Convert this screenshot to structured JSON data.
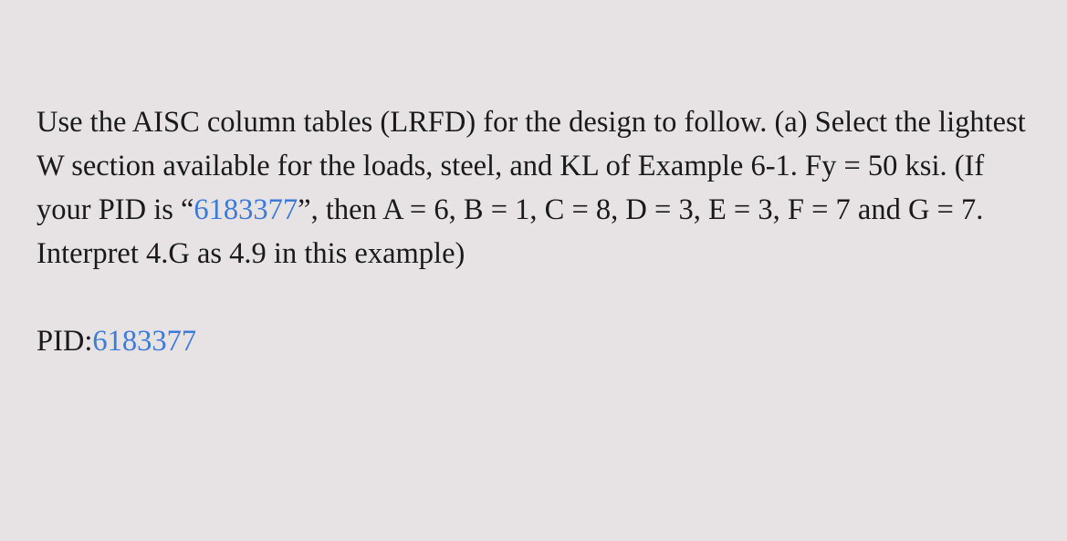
{
  "problem": {
    "text_before_pid": "Use the AISC column tables (LRFD) for the design to follow. (a) Select the lightest W section available for the loads, steel, and KL of Example 6-1. Fy = 50 ksi. (If your PID is “",
    "pid_inline": "6183377",
    "text_after_pid": "”, then A = 6, B = 1, C = 8, D = 3, E = 3, F = 7 and G = 7. Interpret 4.G as 4.9 in this example)"
  },
  "pid": {
    "label": "PID:",
    "value": "6183377"
  }
}
